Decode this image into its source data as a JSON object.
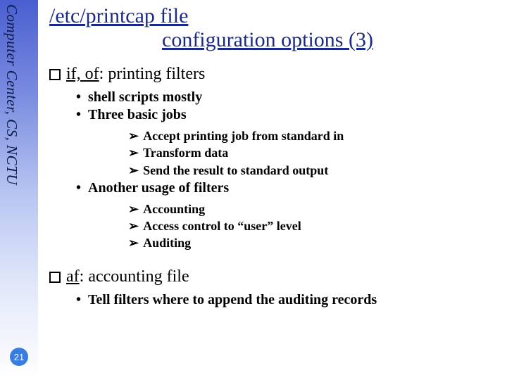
{
  "sidebar": {
    "org": "Computer Center, CS, NCTU"
  },
  "page_number": "21",
  "title": {
    "line1": "/etc/printcap file",
    "line2": "configuration options (3)"
  },
  "sections": [
    {
      "heading_key": "if, of",
      "heading_rest": ": printing filters",
      "bullets": [
        {
          "text": "shell scripts mostly"
        },
        {
          "text": "Three basic jobs",
          "sub": [
            "Accept printing job from standard in",
            "Transform data",
            "Send the result to standard output"
          ]
        },
        {
          "text": "Another usage of filters",
          "sub": [
            "Accounting",
            "Access control to “user” level",
            "Auditing"
          ]
        }
      ]
    },
    {
      "heading_key": "af",
      "heading_rest": ": accounting file",
      "bullets": [
        {
          "text": "Tell filters where to append the auditing records"
        }
      ]
    }
  ]
}
